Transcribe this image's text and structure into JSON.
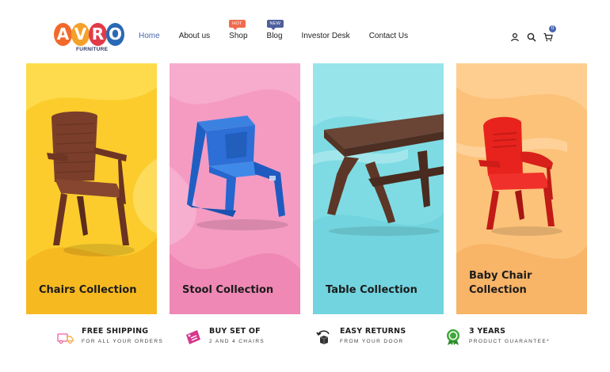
{
  "brand": {
    "letters": [
      "A",
      "V",
      "R",
      "O"
    ],
    "letter_colors": [
      "#f26a2b",
      "#f4a12a",
      "#e23a48",
      "#2a69b5"
    ],
    "subtitle": "FURNITURE"
  },
  "nav": {
    "items": [
      {
        "label": "Home",
        "active": true
      },
      {
        "label": "About us"
      },
      {
        "label": "Shop",
        "badge": "HOT",
        "badge_color": "#f06b4e"
      },
      {
        "label": "Blog",
        "badge": "NEW",
        "badge_color": "#4d5f9c"
      },
      {
        "label": "Investor Desk"
      },
      {
        "label": "Contact Us"
      }
    ]
  },
  "header_icons": {
    "user": "user-icon",
    "search": "search-icon",
    "cart": "cart-icon",
    "cart_count": "0"
  },
  "collections": [
    {
      "title": "Chairs Collection",
      "color_from": "#ffdc3a",
      "color_to": "#f6b51e",
      "icon": "chair"
    },
    {
      "title": "Stool Collection",
      "color_from": "#f7a2c6",
      "color_to": "#ee86b4",
      "icon": "stool"
    },
    {
      "title": "Table Collection",
      "color_from": "#8fe2ea",
      "color_to": "#6fd6e0",
      "icon": "table"
    },
    {
      "title": "Baby Chair\nCollection",
      "color_from": "#ffcb86",
      "color_to": "#f8b56a",
      "icon": "baby-chair"
    }
  ],
  "features": [
    {
      "title": "FREE SHIPPING",
      "subtitle": "FOR ALL YOUR ORDERS",
      "icon": "truck-icon"
    },
    {
      "title": "BUY SET OF",
      "subtitle": "2 AND 4 CHAIRS",
      "icon": "set-off-icon"
    },
    {
      "title": "EASY RETURNS",
      "subtitle": "FROM YOUR DOOR",
      "icon": "returns-icon"
    },
    {
      "title": "3 YEARS",
      "subtitle": "PRODUCT GUARANTEE*",
      "icon": "guarantee-icon"
    }
  ]
}
